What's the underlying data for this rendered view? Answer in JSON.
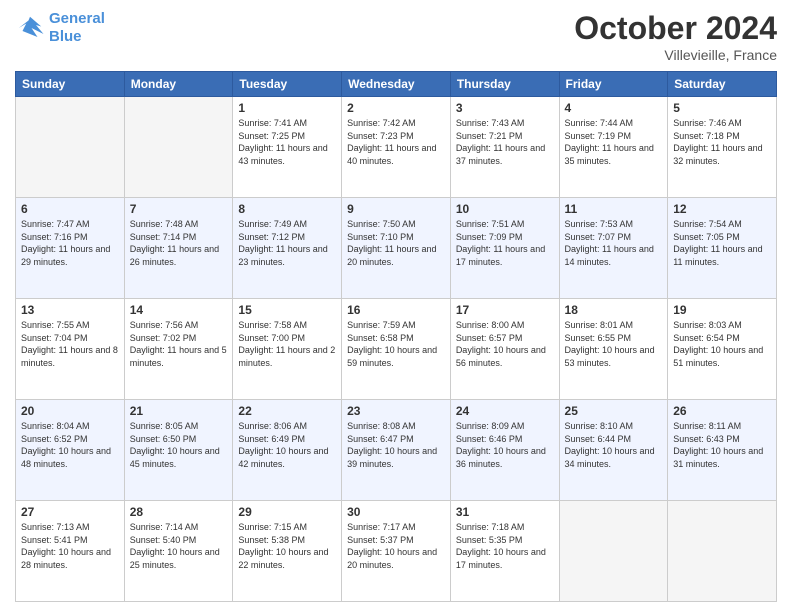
{
  "header": {
    "logo_line1": "General",
    "logo_line2": "Blue",
    "month": "October 2024",
    "location": "Villevieille, France"
  },
  "weekdays": [
    "Sunday",
    "Monday",
    "Tuesday",
    "Wednesday",
    "Thursday",
    "Friday",
    "Saturday"
  ],
  "weeks": [
    [
      {
        "day": "",
        "sunrise": "",
        "sunset": "",
        "daylight": ""
      },
      {
        "day": "",
        "sunrise": "",
        "sunset": "",
        "daylight": ""
      },
      {
        "day": "1",
        "sunrise": "Sunrise: 7:41 AM",
        "sunset": "Sunset: 7:25 PM",
        "daylight": "Daylight: 11 hours and 43 minutes."
      },
      {
        "day": "2",
        "sunrise": "Sunrise: 7:42 AM",
        "sunset": "Sunset: 7:23 PM",
        "daylight": "Daylight: 11 hours and 40 minutes."
      },
      {
        "day": "3",
        "sunrise": "Sunrise: 7:43 AM",
        "sunset": "Sunset: 7:21 PM",
        "daylight": "Daylight: 11 hours and 37 minutes."
      },
      {
        "day": "4",
        "sunrise": "Sunrise: 7:44 AM",
        "sunset": "Sunset: 7:19 PM",
        "daylight": "Daylight: 11 hours and 35 minutes."
      },
      {
        "day": "5",
        "sunrise": "Sunrise: 7:46 AM",
        "sunset": "Sunset: 7:18 PM",
        "daylight": "Daylight: 11 hours and 32 minutes."
      }
    ],
    [
      {
        "day": "6",
        "sunrise": "Sunrise: 7:47 AM",
        "sunset": "Sunset: 7:16 PM",
        "daylight": "Daylight: 11 hours and 29 minutes."
      },
      {
        "day": "7",
        "sunrise": "Sunrise: 7:48 AM",
        "sunset": "Sunset: 7:14 PM",
        "daylight": "Daylight: 11 hours and 26 minutes."
      },
      {
        "day": "8",
        "sunrise": "Sunrise: 7:49 AM",
        "sunset": "Sunset: 7:12 PM",
        "daylight": "Daylight: 11 hours and 23 minutes."
      },
      {
        "day": "9",
        "sunrise": "Sunrise: 7:50 AM",
        "sunset": "Sunset: 7:10 PM",
        "daylight": "Daylight: 11 hours and 20 minutes."
      },
      {
        "day": "10",
        "sunrise": "Sunrise: 7:51 AM",
        "sunset": "Sunset: 7:09 PM",
        "daylight": "Daylight: 11 hours and 17 minutes."
      },
      {
        "day": "11",
        "sunrise": "Sunrise: 7:53 AM",
        "sunset": "Sunset: 7:07 PM",
        "daylight": "Daylight: 11 hours and 14 minutes."
      },
      {
        "day": "12",
        "sunrise": "Sunrise: 7:54 AM",
        "sunset": "Sunset: 7:05 PM",
        "daylight": "Daylight: 11 hours and 11 minutes."
      }
    ],
    [
      {
        "day": "13",
        "sunrise": "Sunrise: 7:55 AM",
        "sunset": "Sunset: 7:04 PM",
        "daylight": "Daylight: 11 hours and 8 minutes."
      },
      {
        "day": "14",
        "sunrise": "Sunrise: 7:56 AM",
        "sunset": "Sunset: 7:02 PM",
        "daylight": "Daylight: 11 hours and 5 minutes."
      },
      {
        "day": "15",
        "sunrise": "Sunrise: 7:58 AM",
        "sunset": "Sunset: 7:00 PM",
        "daylight": "Daylight: 11 hours and 2 minutes."
      },
      {
        "day": "16",
        "sunrise": "Sunrise: 7:59 AM",
        "sunset": "Sunset: 6:58 PM",
        "daylight": "Daylight: 10 hours and 59 minutes."
      },
      {
        "day": "17",
        "sunrise": "Sunrise: 8:00 AM",
        "sunset": "Sunset: 6:57 PM",
        "daylight": "Daylight: 10 hours and 56 minutes."
      },
      {
        "day": "18",
        "sunrise": "Sunrise: 8:01 AM",
        "sunset": "Sunset: 6:55 PM",
        "daylight": "Daylight: 10 hours and 53 minutes."
      },
      {
        "day": "19",
        "sunrise": "Sunrise: 8:03 AM",
        "sunset": "Sunset: 6:54 PM",
        "daylight": "Daylight: 10 hours and 51 minutes."
      }
    ],
    [
      {
        "day": "20",
        "sunrise": "Sunrise: 8:04 AM",
        "sunset": "Sunset: 6:52 PM",
        "daylight": "Daylight: 10 hours and 48 minutes."
      },
      {
        "day": "21",
        "sunrise": "Sunrise: 8:05 AM",
        "sunset": "Sunset: 6:50 PM",
        "daylight": "Daylight: 10 hours and 45 minutes."
      },
      {
        "day": "22",
        "sunrise": "Sunrise: 8:06 AM",
        "sunset": "Sunset: 6:49 PM",
        "daylight": "Daylight: 10 hours and 42 minutes."
      },
      {
        "day": "23",
        "sunrise": "Sunrise: 8:08 AM",
        "sunset": "Sunset: 6:47 PM",
        "daylight": "Daylight: 10 hours and 39 minutes."
      },
      {
        "day": "24",
        "sunrise": "Sunrise: 8:09 AM",
        "sunset": "Sunset: 6:46 PM",
        "daylight": "Daylight: 10 hours and 36 minutes."
      },
      {
        "day": "25",
        "sunrise": "Sunrise: 8:10 AM",
        "sunset": "Sunset: 6:44 PM",
        "daylight": "Daylight: 10 hours and 34 minutes."
      },
      {
        "day": "26",
        "sunrise": "Sunrise: 8:11 AM",
        "sunset": "Sunset: 6:43 PM",
        "daylight": "Daylight: 10 hours and 31 minutes."
      }
    ],
    [
      {
        "day": "27",
        "sunrise": "Sunrise: 7:13 AM",
        "sunset": "Sunset: 5:41 PM",
        "daylight": "Daylight: 10 hours and 28 minutes."
      },
      {
        "day": "28",
        "sunrise": "Sunrise: 7:14 AM",
        "sunset": "Sunset: 5:40 PM",
        "daylight": "Daylight: 10 hours and 25 minutes."
      },
      {
        "day": "29",
        "sunrise": "Sunrise: 7:15 AM",
        "sunset": "Sunset: 5:38 PM",
        "daylight": "Daylight: 10 hours and 22 minutes."
      },
      {
        "day": "30",
        "sunrise": "Sunrise: 7:17 AM",
        "sunset": "Sunset: 5:37 PM",
        "daylight": "Daylight: 10 hours and 20 minutes."
      },
      {
        "day": "31",
        "sunrise": "Sunrise: 7:18 AM",
        "sunset": "Sunset: 5:35 PM",
        "daylight": "Daylight: 10 hours and 17 minutes."
      },
      {
        "day": "",
        "sunrise": "",
        "sunset": "",
        "daylight": ""
      },
      {
        "day": "",
        "sunrise": "",
        "sunset": "",
        "daylight": ""
      }
    ]
  ]
}
